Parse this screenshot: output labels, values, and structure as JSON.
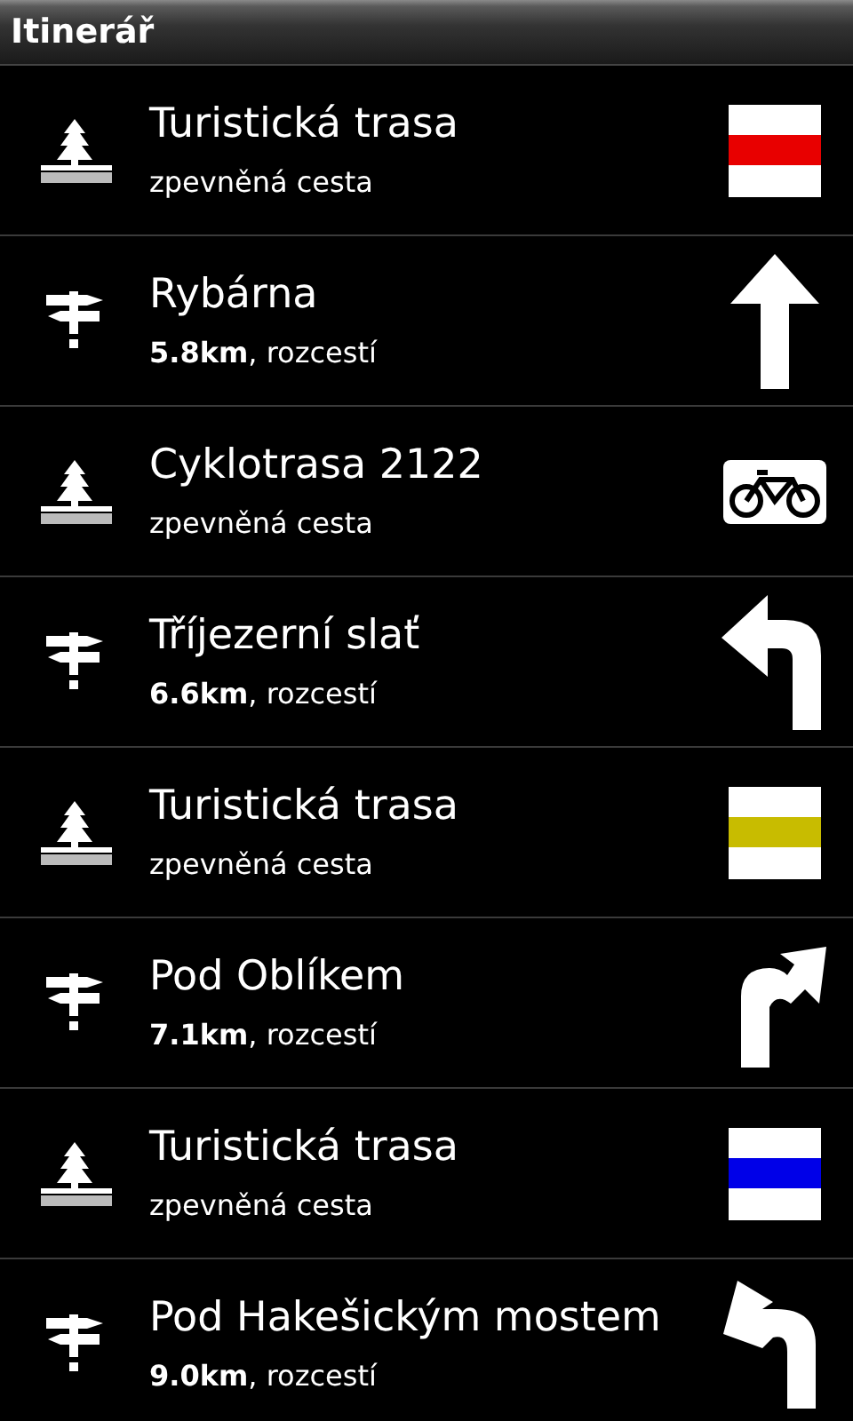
{
  "title_bar": {
    "title": "Itinerář"
  },
  "items": [
    {
      "kind": "trail",
      "name": "Turistická trasa",
      "detail": "zpevněná cesta",
      "sign": {
        "kind": "stripe",
        "color": "#e80000"
      }
    },
    {
      "kind": "junction",
      "name": "Rybárna",
      "detail": "**5.8km**, rozcestí",
      "sign": {
        "kind": "straight"
      }
    },
    {
      "kind": "trail",
      "name": "Cyklotrasa 2122",
      "detail": "zpevněná cesta",
      "sign": {
        "kind": "bike"
      }
    },
    {
      "kind": "junction",
      "name": "Tříjezerní slať",
      "detail": "**6.6km**, rozcestí",
      "sign": {
        "kind": "left"
      }
    },
    {
      "kind": "trail",
      "name": "Turistická trasa",
      "detail": "zpevněná cesta",
      "sign": {
        "kind": "stripe",
        "color": "#c8bc00"
      }
    },
    {
      "kind": "junction",
      "name": "Pod Oblíkem",
      "detail": "**7.1km**, rozcestí",
      "sign": {
        "kind": "right"
      }
    },
    {
      "kind": "trail",
      "name": "Turistická trasa",
      "detail": "zpevněná cesta",
      "sign": {
        "kind": "stripe",
        "color": "#0000e8"
      }
    },
    {
      "kind": "junction",
      "name": "Pod Hakešickým mostem",
      "detail": "**9.0km**, rozcestí",
      "sign": {
        "kind": "sharp-left"
      }
    }
  ]
}
